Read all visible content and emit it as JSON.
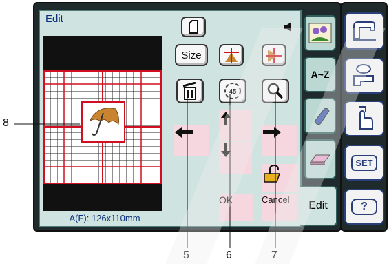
{
  "panel": {
    "title": "Edit"
  },
  "buttons": {
    "size": "Size",
    "ok": "OK",
    "cancel": "Cancel"
  },
  "tabs": {
    "alphabet": "A~Z",
    "edit": "Edit"
  },
  "readout": "A(F): 126x110mm",
  "right_column": {
    "set": "SET",
    "help": "?"
  },
  "callouts": [
    "8",
    "5",
    "6",
    "7"
  ],
  "icons": {
    "mirror": "mirror-icon",
    "rotate": "rotate-45-icon",
    "zoom": "magnifier-icon",
    "delete": "trash-icon",
    "unlock": "unlock-icon"
  },
  "rotate_label": "45"
}
